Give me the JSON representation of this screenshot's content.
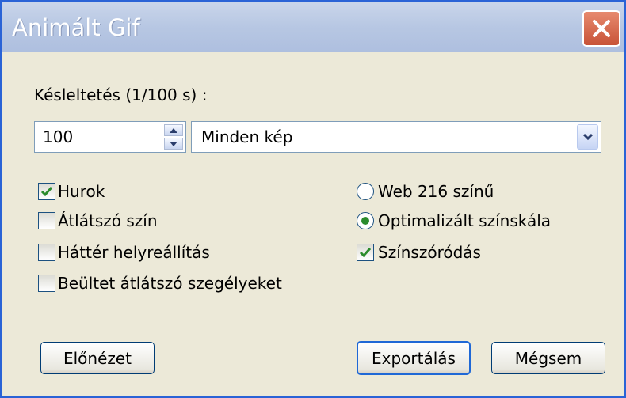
{
  "window": {
    "title": "Animált Gif"
  },
  "delay": {
    "label": "Késleltetés (1/100 s) :",
    "value": "100",
    "scope_value": "Minden kép"
  },
  "left_options": [
    {
      "label": "Hurok",
      "checked": true
    },
    {
      "label": "Átlátszó szín",
      "checked": false
    },
    {
      "label": "Háttér helyreállítás",
      "checked": false
    },
    {
      "label": "Beültet átlátszó szegélyeket",
      "checked": false
    }
  ],
  "palette_options": [
    {
      "label": "Web 216 színű",
      "selected": false
    },
    {
      "label": "Optimalizált színskála",
      "selected": true
    }
  ],
  "dither": {
    "label": "Színszóródás",
    "checked": true
  },
  "buttons": {
    "preview": "Előnézet",
    "export": "Exportálás",
    "cancel": "Mégsem"
  },
  "colors": {
    "titlebar": "#b7c7e3",
    "dialog_bg": "#ece9d8",
    "check_green": "#2b8b2b",
    "close_red": "#c85338"
  }
}
